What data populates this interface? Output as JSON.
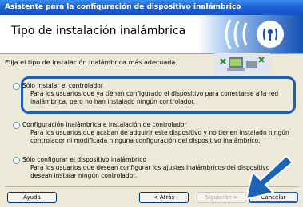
{
  "window": {
    "title": "Asistente para la configuración de dispositivo inalámbrico"
  },
  "header": {
    "title": "Tipo de instalación inalámbrica"
  },
  "instruction": "Elija el tipo de instalación inalámbrica más adecuada.",
  "options": [
    {
      "label": "Sólo instalar el controlador",
      "desc_line1": "Para los usuarios que ya tienen configurado el dispositivo para conectarse a la red",
      "desc_line2": "inalámbrica, pero no han instalado ningún controlador.",
      "selected": false
    },
    {
      "label": "Configuración inalámbrica e instalación de controlador",
      "desc_line1": "Para los usuarios que acaban de adquirir este dispositivo y no tienen instalado ningún",
      "desc_line2": "controlador ni modificada ninguna configuración del dispositivo inalámbrico.",
      "selected": false
    },
    {
      "label": "Sólo configurar el dispositivo inalámbrico",
      "desc_line1": "Para los usuarios que desean configurar los ajustes inalámbricos del dispositivo",
      "desc_line2": "desean instalar ningún controlador.",
      "selected": false
    }
  ],
  "buttons": {
    "help": "Ayuda",
    "back": "< Atrás",
    "next": "Siguiente >",
    "cancel": "Cancelar"
  },
  "colors": {
    "highlight": "#1e5fb3",
    "arrow": "#1c63b7",
    "titlebar": "#1f62d6"
  },
  "icons": {
    "logo": "wireless-logo-icon",
    "computer": "wireless-pc-icon",
    "pointer": "pointer-arrow-icon"
  }
}
